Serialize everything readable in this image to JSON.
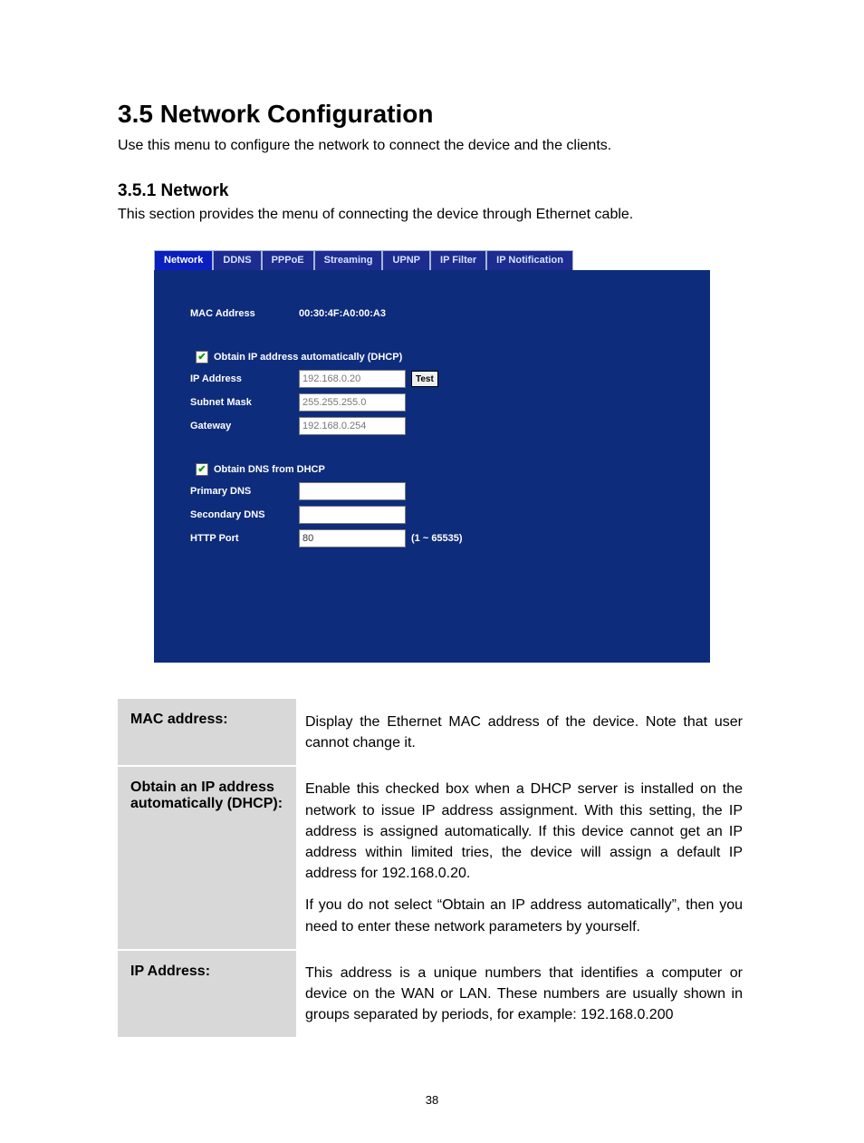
{
  "heading": "3.5 Network Configuration",
  "intro": "Use this menu to configure the network to connect the device and the clients.",
  "sub_heading": "3.5.1 Network",
  "sub_intro": "This section provides the menu of connecting the device through Ethernet cable.",
  "tabs": [
    "Network",
    "DDNS",
    "PPPoE",
    "Streaming",
    "UPNP",
    "IP Filter",
    "IP Notification"
  ],
  "active_tab_index": 0,
  "panel": {
    "mac_label": "MAC Address",
    "mac_value": "00:30:4F:A0:00:A3",
    "dhcp_checkbox_label": "Obtain IP address automatically (DHCP)",
    "dhcp_checkbox_checked": true,
    "ip_label": "IP Address",
    "ip_value": "192.168.0.20",
    "test_btn": "Test",
    "subnet_label": "Subnet Mask",
    "subnet_value": "255.255.255.0",
    "gateway_label": "Gateway",
    "gateway_value": "192.168.0.254",
    "dns_dhcp_label": "Obtain DNS from DHCP",
    "dns_dhcp_checked": true,
    "primary_dns_label": "Primary DNS",
    "primary_dns_value": "",
    "secondary_dns_label": "Secondary DNS",
    "secondary_dns_value": "",
    "http_port_label": "HTTP Port",
    "http_port_value": "80",
    "http_port_hint": "(1 ~ 65535)"
  },
  "desc": [
    {
      "term": "MAC address:",
      "paras": [
        "Display the Ethernet MAC address of the device. Note that user cannot change it."
      ]
    },
    {
      "term": "Obtain an IP address automatically (DHCP):",
      "paras": [
        "Enable this checked box when a DHCP server is installed on the network to issue IP address assignment. With this setting, the IP address is assigned automatically. If this device cannot get an IP address within limited tries, the device will assign a default IP address for 192.168.0.20.",
        "If you do not select “Obtain an IP address automatically”, then you need to enter these network parameters by yourself."
      ]
    },
    {
      "term": "IP Address:",
      "paras": [
        "This address is a unique numbers that identifies a computer or device on the WAN or LAN. These numbers are usually shown in groups separated by periods, for example: 192.168.0.200"
      ]
    }
  ],
  "page_number": "38"
}
